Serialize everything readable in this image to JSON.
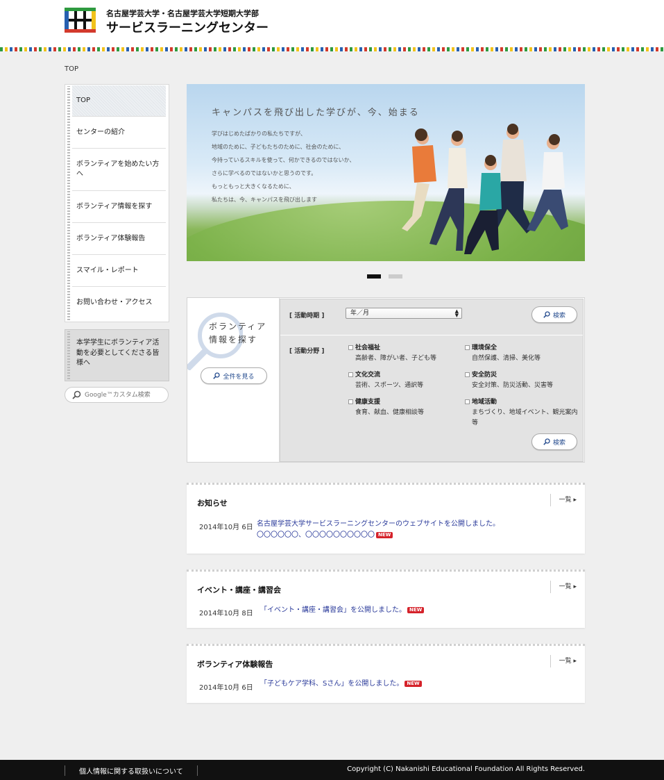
{
  "header": {
    "logo_sub": "名古屋学芸大学・名古屋学芸大学短期大学部",
    "logo_main": "サービスラーニングセンター"
  },
  "breadcrumb": "TOP",
  "sidebar": {
    "items": [
      {
        "label": "TOP"
      },
      {
        "label": "センターの紹介"
      },
      {
        "label": "ボランティアを始めたい方へ"
      },
      {
        "label": "ボランティア情報を探す"
      },
      {
        "label": "ボランティア体験報告"
      },
      {
        "label": "スマイル・レポート"
      },
      {
        "label": "お問い合わせ・アクセス"
      }
    ],
    "notice": "本学学生にボランティア活動を必要としてくださる皆様へ",
    "search_placeholder": "Google™カスタム検索"
  },
  "hero": {
    "title": "キャンパスを飛び出した学びが、今、始まる",
    "lines": [
      "学びはじめたばかりの私たちですが、",
      "地域のために、子どもたちのために、社会のために、",
      "今持っているスキルを使って、何かできるのではないか、",
      "さらに学べるのではないかと思うのです。",
      "もっともっと大きくなるために、",
      "私たちは、今、キャンパスを飛び出します"
    ],
    "active_slide": 1,
    "slides": 2
  },
  "volunteer_search": {
    "title_line1": "ボランティア",
    "title_line2": "情報を探す",
    "all_button": "全件を見る",
    "period_label": "[ 活動時期 ]",
    "period_value": "年／月",
    "search_button": "検索",
    "field_label": "[ 活動分野 ]",
    "categories": [
      {
        "title": "社会福祉",
        "desc": "高齢者、障がい者、子ども等"
      },
      {
        "title": "環境保全",
        "desc": "自然保護、清掃、美化等"
      },
      {
        "title": "文化交流",
        "desc": "芸術、スポーツ、通訳等"
      },
      {
        "title": "安全防災",
        "desc": "安全対策、防災活動、災害等"
      },
      {
        "title": "健康支援",
        "desc": "食育、献血、健康相談等"
      },
      {
        "title": "地域活動",
        "desc": "まちづくり、地域イベント、観光案内等"
      }
    ]
  },
  "sections": [
    {
      "title": "お知らせ",
      "more": "一覧",
      "date": "2014年10月 6日",
      "item_line1": "名古屋学芸大学サービスラーニングセンターのウェブサイトを公開しました。",
      "item_line2": "〇〇〇〇〇〇、〇〇〇〇〇〇〇〇〇〇",
      "badge": "NEW"
    },
    {
      "title": "イベント・講座・講習会",
      "more": "一覧",
      "date": "2014年10月 8日",
      "item_line1": "「イベント・講座・講習会」を公開しました。",
      "badge": "NEW"
    },
    {
      "title": "ボランティア体験報告",
      "more": "一覧",
      "date": "2014年10月 6日",
      "item_line1": "「子どもケア学科、Sさん」を公開しました。",
      "badge": "NEW"
    }
  ],
  "footer": {
    "privacy_link": "個人情報に関する取扱いについて",
    "copyright": "Copyright (C) Nakanishi Educational Foundation All Rights Reserved."
  },
  "colors": {
    "accent_link": "#2a3a9a",
    "new_badge": "#d5222a",
    "footer_bg": "#111111"
  }
}
